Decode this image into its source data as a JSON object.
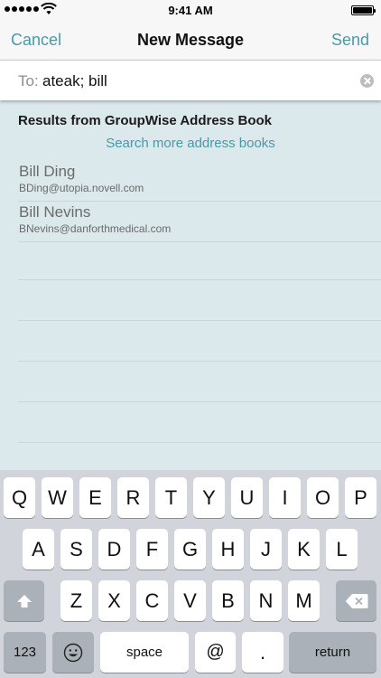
{
  "status_bar": {
    "time": "9:41 AM"
  },
  "nav": {
    "cancel_label": "Cancel",
    "title": "New Message",
    "send_label": "Send"
  },
  "to_field": {
    "label": "To:",
    "value": "ateak; bill"
  },
  "results": {
    "header": "Results from GroupWise Address Book",
    "search_more": "Search more address books",
    "contacts": [
      {
        "name": "Bill Ding",
        "email": "BDing@utopia.novell.com"
      },
      {
        "name": "Bill Nevins",
        "email": "BNevins@danforthmedical.com"
      }
    ]
  },
  "keyboard": {
    "row1": [
      "Q",
      "W",
      "E",
      "R",
      "T",
      "Y",
      "U",
      "I",
      "O",
      "P"
    ],
    "row2": [
      "A",
      "S",
      "D",
      "F",
      "G",
      "H",
      "J",
      "K",
      "L"
    ],
    "row3": [
      "Z",
      "X",
      "C",
      "V",
      "B",
      "N",
      "M"
    ],
    "numbers_label": "123",
    "space_label": "space",
    "at_label": "@",
    "period_label": ".",
    "return_label": "return",
    "shift_icon": "shift-icon",
    "delete_icon": "delete-icon",
    "emoji_icon": "emoji-icon"
  },
  "colors": {
    "accent": "#4a9aa6",
    "background": "#dbe8ec",
    "keyboard_bg": "#d1d5db"
  }
}
